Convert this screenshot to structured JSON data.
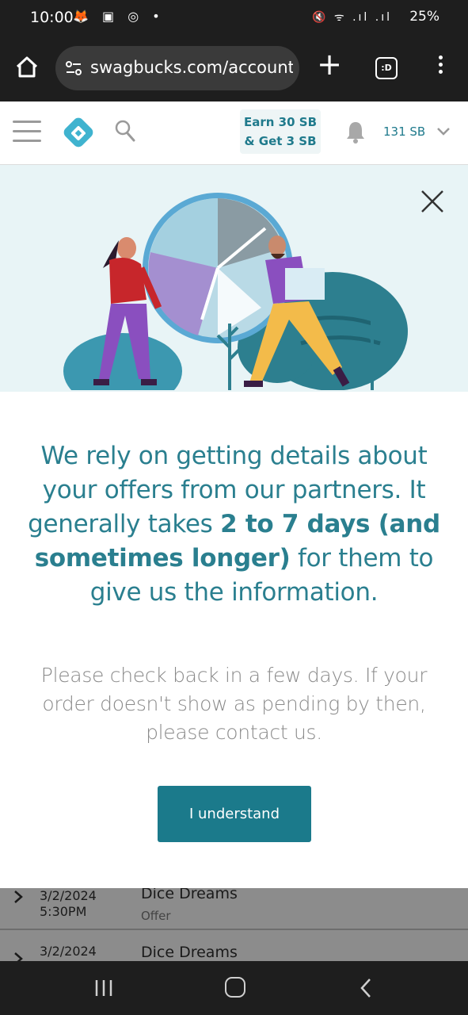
{
  "status_bar": {
    "time": "10:00",
    "left_icons": "🦊 ▣ ◎ •",
    "right_icons": "🔇 ᯤ .ıl .ıl",
    "battery": "25%"
  },
  "browser": {
    "url": "swagbucks.com/account"
  },
  "header": {
    "earn_line1": "Earn 30 SB",
    "earn_line2": "& Get 3 SB",
    "balance": "131 SB",
    "brand_color": "#1f7a8c"
  },
  "modal": {
    "heading_part1": "We rely on getting details about your offers from our partners. It generally takes ",
    "heading_bold": "2 to 7 days (and sometimes longer)",
    "heading_part2": " for them to give us the information.",
    "body": "Please check back in a few days. If your order doesn't show as pending by then, please contact us.",
    "button_label": "I understand",
    "button_color": "#1b7a8b"
  },
  "background_list": {
    "rows": [
      {
        "date": "3/2/2024",
        "time": "5:30PM",
        "title": "Dice Dreams",
        "subtitle": "Offer"
      },
      {
        "date": "3/2/2024",
        "time": "",
        "title": "Dice Dreams",
        "subtitle": ""
      }
    ]
  }
}
